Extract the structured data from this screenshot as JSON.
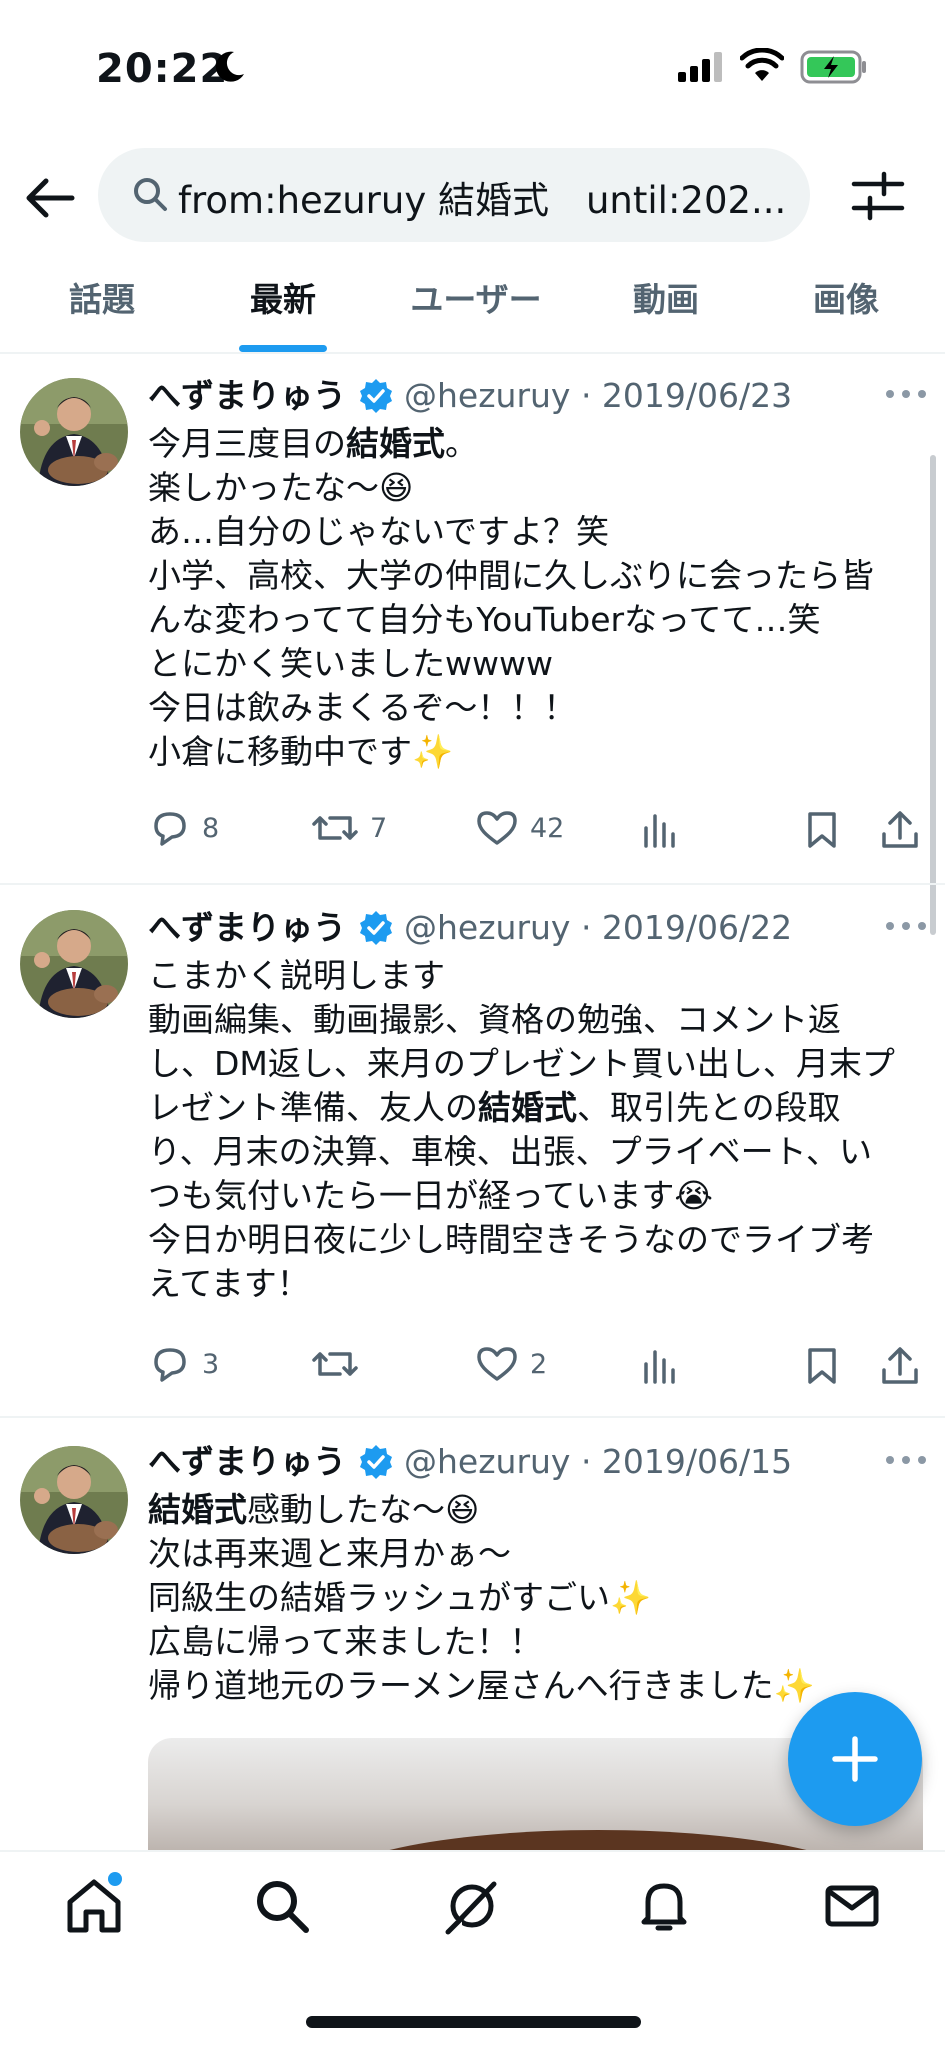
{
  "status_bar": {
    "time": "20:22",
    "icons": [
      "moon-icon",
      "cellular-signal-icon",
      "wifi-icon",
      "battery-charging-icon"
    ]
  },
  "search": {
    "query": "from:hezuruy 結婚式　until:202...",
    "icons": [
      "back-arrow-icon",
      "search-icon",
      "filter-sliders-icon"
    ]
  },
  "tabs": [
    {
      "label": "話題",
      "active": false
    },
    {
      "label": "最新",
      "active": true
    },
    {
      "label": "ユーザー",
      "active": false
    },
    {
      "label": "動画",
      "active": false
    },
    {
      "label": "画像",
      "active": false
    }
  ],
  "tweets": [
    {
      "name": "へずまりゅう",
      "handle_date": "@hezuruy · 2019/06/23",
      "lines": [
        [
          {
            "t": "今月三度目の"
          },
          {
            "t": "結婚式",
            "b": true
          },
          {
            "t": "。"
          }
        ],
        [
          {
            "t": "楽しかったな〜😆"
          }
        ],
        [
          {
            "t": "あ…自分のじゃないですよ？笑"
          }
        ],
        [
          {
            "t": "小学、高校、大学の仲間に久しぶりに会ったら皆"
          }
        ],
        [
          {
            "t": "んな変わってて自分もYouTuberなってて…笑"
          }
        ],
        [
          {
            "t": "とにかく笑いましたwwww"
          }
        ],
        [
          {
            "t": "今日は飲みまくるぞ〜！！！"
          }
        ],
        [
          {
            "t": "小倉に移動中です✨"
          }
        ]
      ],
      "replies": "8",
      "retweets": "7",
      "likes": "42"
    },
    {
      "name": "へずまりゅう",
      "handle_date": "@hezuruy · 2019/06/22",
      "lines": [
        [
          {
            "t": "こまかく説明します"
          }
        ],
        [
          {
            "t": "動画編集、動画撮影、資格の勉強、コメント返"
          }
        ],
        [
          {
            "t": "し、DM返し、来月のプレゼント買い出し、月末プ"
          }
        ],
        [
          {
            "t": "レゼント準備、友人の"
          },
          {
            "t": "結婚式",
            "b": true
          },
          {
            "t": "、取引先との段取"
          }
        ],
        [
          {
            "t": "り、月末の決算、車検、出張、プライベート、い"
          }
        ],
        [
          {
            "t": "つも気付いたら一日が経っています😭"
          }
        ],
        [
          {
            "t": "今日か明日夜に少し時間空きそうなのでライブ考"
          }
        ],
        [
          {
            "t": "えてます！"
          }
        ]
      ],
      "replies": "3",
      "retweets": "",
      "likes": "2"
    },
    {
      "name": "へずまりゅう",
      "handle_date": "@hezuruy · 2019/06/15",
      "lines": [
        [
          {
            "t": "結婚式",
            "b": true
          },
          {
            "t": "感動したな〜😆"
          }
        ],
        [
          {
            "t": "次は再来週と来月かぁ〜"
          }
        ],
        [
          {
            "t": "同級生の結婚ラッシュがすごい✨"
          }
        ],
        [
          {
            "t": "広島に帰って来ました！！"
          }
        ],
        [
          {
            "t": "帰り道地元のラーメン屋さんへ行きました✨"
          }
        ]
      ]
    }
  ],
  "fab": {
    "icon": "plus-icon"
  },
  "bottom_nav": [
    "home-icon",
    "search-icon",
    "grok-icon",
    "notifications-bell-icon",
    "messages-envelope-icon"
  ],
  "colors": {
    "accent": "#1d9bf0",
    "secondary_text": "#536471",
    "divider": "#eff3f4"
  }
}
